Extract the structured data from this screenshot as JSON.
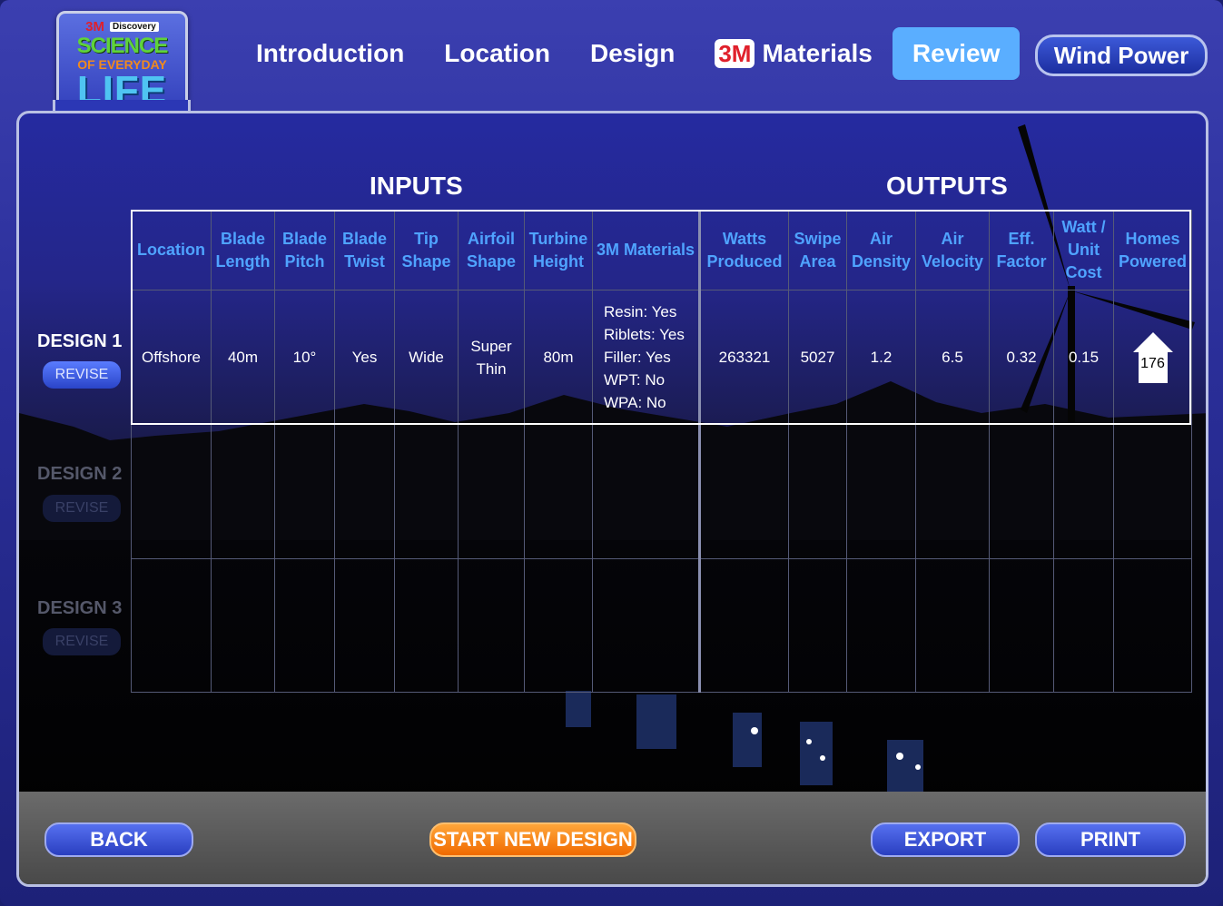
{
  "logo": {
    "brand_3m": "3M",
    "brand_discovery": "Discovery",
    "line1": "SCIENCE",
    "line2": "OF EVERYDAY",
    "line3": "LIFE"
  },
  "nav": {
    "items": [
      {
        "label": "Introduction"
      },
      {
        "label": "Location"
      },
      {
        "label": "Design"
      },
      {
        "label": "Materials",
        "badge": "3M"
      },
      {
        "label": "Review"
      }
    ],
    "module_button": "Wind Power"
  },
  "headings": {
    "inputs": "INPUTS",
    "outputs": "OUTPUTS"
  },
  "table": {
    "headers": [
      "Location",
      "Blade Length",
      "Blade Pitch",
      "Blade Twist",
      "Tip Shape",
      "Airfoil Shape",
      "Turbine Height",
      "3M Materials",
      "Watts Produced",
      "Swipe Area",
      "Air Density",
      "Air Velocity",
      "Eff. Factor",
      "Watt / Unit Cost",
      "Homes Powered"
    ],
    "design1": {
      "location": "Offshore",
      "blade_length": "40m",
      "blade_pitch": "10°",
      "blade_twist": "Yes",
      "tip_shape": "Wide",
      "airfoil_shape": "Super Thin",
      "turbine_height": "80m",
      "materials": [
        "Resin: Yes",
        "Riblets: Yes",
        "Filler: Yes",
        "WPT: No",
        "WPA: No"
      ],
      "watts_produced": "263321",
      "swipe_area": "5027",
      "air_density": "1.2",
      "air_velocity": "6.5",
      "eff_factor": "0.32",
      "watt_unit_cost": "0.15",
      "homes_powered": "176"
    }
  },
  "designs": [
    {
      "label": "DESIGN 1",
      "revise": "REVISE",
      "active": true
    },
    {
      "label": "DESIGN 2",
      "revise": "REVISE",
      "active": false
    },
    {
      "label": "DESIGN 3",
      "revise": "REVISE",
      "active": false
    }
  ],
  "footer": {
    "back": "BACK",
    "start_new": "START NEW DESIGN",
    "export": "EXPORT",
    "print": "PRINT"
  },
  "colors": {
    "header_text": "#4fa3ff",
    "active_tab": "#5aaeff",
    "accent_orange": "#f07a10"
  }
}
